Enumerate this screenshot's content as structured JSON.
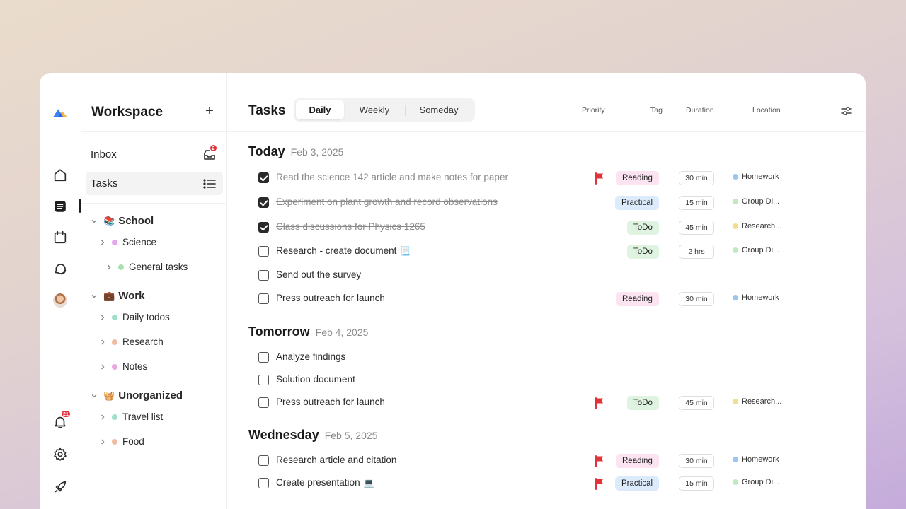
{
  "colors": {
    "accent_blue": "#3b82f6",
    "accent_yellow": "#f5b53d",
    "flag_red": "#e2333a",
    "tag_reading": "#fbe3f1",
    "tag_practical": "#dcebfb",
    "tag_todo": "#dff4e0"
  },
  "rail": {
    "items": [
      "logo-icon",
      "home-icon",
      "tasks-icon",
      "calendar-icon",
      "chat-icon",
      "avatar",
      "bell-icon",
      "settings-icon",
      "rocket-icon"
    ],
    "notifications_badge": "21"
  },
  "sidebar": {
    "title": "Workspace",
    "add_icon": "+",
    "inbox_label": "Inbox",
    "inbox_badge": "2",
    "tasks_label": "Tasks",
    "groups": [
      {
        "emoji": "📚",
        "name": "School",
        "projects": [
          {
            "name": "Science",
            "color": "#e3a6ec"
          },
          {
            "name": "General tasks",
            "color": "#a7e1b1"
          }
        ]
      },
      {
        "emoji": "💼",
        "name": "Work",
        "projects": [
          {
            "name": "Daily todos",
            "color": "#9fe0c8"
          },
          {
            "name": "Research",
            "color": "#f2bca1"
          },
          {
            "name": "Notes",
            "color": "#eca8e0"
          }
        ]
      },
      {
        "emoji": "🧺",
        "name": "Unorganized",
        "projects": [
          {
            "name": "Travel list",
            "color": "#9fe0c8"
          },
          {
            "name": "Food",
            "color": "#f2bca1"
          }
        ]
      }
    ]
  },
  "header": {
    "title": "Tasks",
    "tabs": [
      "Daily",
      "Weekly",
      "Someday"
    ],
    "active_tab": "Daily",
    "columns": {
      "priority": "Priority",
      "tag": "Tag",
      "duration": "Duration",
      "location": "Location"
    }
  },
  "sections": [
    {
      "title": "Today",
      "date": "Feb 3, 2025",
      "tasks": [
        {
          "title": "Read the science 142 article and make notes for paper",
          "done": true,
          "flag": true,
          "tag": "Reading",
          "tag_type": "reading",
          "duration": "30 min",
          "location": "Homework",
          "loc_color": "#9cc6f2"
        },
        {
          "title": "Experiment on plant growth and record observations",
          "done": true,
          "flag": false,
          "tag": "Practical",
          "tag_type": "practical",
          "duration": "15 min",
          "location": "Group Di...",
          "loc_color": "#bfe8c4"
        },
        {
          "title": "Class discussions for Physics 1265",
          "done": true,
          "flag": false,
          "tag": "ToDo",
          "tag_type": "todo",
          "duration": "45 min",
          "location": "Research...",
          "loc_color": "#f6dc8f"
        },
        {
          "title": "Research - create document",
          "done": false,
          "flag": false,
          "doc": "📃",
          "tag": "ToDo",
          "tag_type": "todo",
          "duration": "2 hrs",
          "location": "Group Di...",
          "loc_color": "#bfe8c4"
        },
        {
          "title": "Send out the survey",
          "done": false,
          "flag": false
        },
        {
          "title": "Press outreach for launch",
          "done": false,
          "flag": false,
          "tag": "Reading",
          "tag_type": "reading",
          "duration": "30 min",
          "location": "Homework",
          "loc_color": "#9cc6f2"
        }
      ]
    },
    {
      "title": "Tomorrow",
      "date": "Feb 4, 2025",
      "tasks": [
        {
          "title": "Analyze findings",
          "done": false,
          "flag": false
        },
        {
          "title": "Solution document",
          "done": false,
          "flag": false
        },
        {
          "title": "Press outreach for launch",
          "done": false,
          "flag": true,
          "tag": "ToDo",
          "tag_type": "todo",
          "duration": "45 min",
          "location": "Research...",
          "loc_color": "#f6dc8f"
        }
      ]
    },
    {
      "title": "Wednesday",
      "date": "Feb 5, 2025",
      "tasks": [
        {
          "title": "Research article and citation",
          "done": false,
          "flag": true,
          "tag": "Reading",
          "tag_type": "reading",
          "duration": "30 min",
          "location": "Homework",
          "loc_color": "#9cc6f2"
        },
        {
          "title": "Create presentation",
          "done": false,
          "flag": true,
          "doc": "💻",
          "tag": "Practical",
          "tag_type": "practical",
          "duration": "15 min",
          "location": "Group Di...",
          "loc_color": "#bfe8c4"
        }
      ]
    }
  ]
}
